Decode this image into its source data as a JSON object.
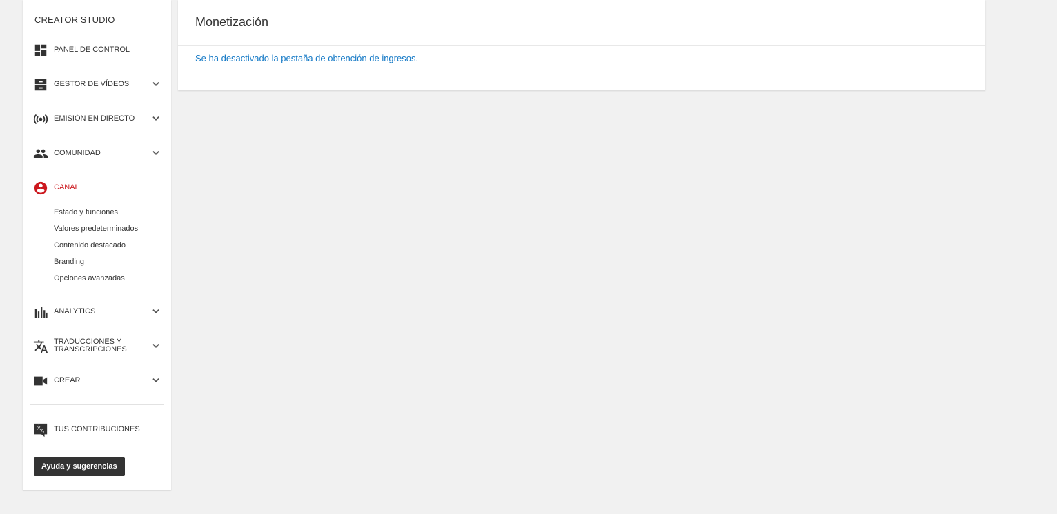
{
  "sidebar": {
    "title": "CREATOR STUDIO",
    "items": [
      {
        "label": "PANEL DE CONTROL",
        "icon": "dashboard-icon",
        "expandable": false
      },
      {
        "label": "GESTOR DE VÍDEOS",
        "icon": "video-manager-icon",
        "expandable": true
      },
      {
        "label": "EMISIÓN EN DIRECTO",
        "icon": "live-broadcast-icon",
        "expandable": true
      },
      {
        "label": "COMUNIDAD",
        "icon": "community-icon",
        "expandable": true
      },
      {
        "label": "CANAL",
        "icon": "channel-icon",
        "expandable": false,
        "active": true
      },
      {
        "label": "ANALYTICS",
        "icon": "analytics-icon",
        "expandable": true
      },
      {
        "label": "TRADUCCIONES Y TRANSCRIPCIONES",
        "icon": "translate-icon",
        "expandable": true
      },
      {
        "label": "CREAR",
        "icon": "video-camera-icon",
        "expandable": true
      }
    ],
    "canal_subitems": [
      "Estado y funciones",
      "Valores predeterminados",
      "Contenido destacado",
      "Branding",
      "Opciones avanzadas"
    ],
    "contributions_label": "TUS CONTRIBUCIONES",
    "help_button": "Ayuda y sugerencias"
  },
  "main": {
    "title": "Monetización",
    "message": "Se ha desactivado la pestaña de obtención de ingresos."
  },
  "colors": {
    "accent_red": "#cc181e",
    "link_blue": "#167ac6",
    "background": "#f1f1f1",
    "text": "#333333"
  }
}
